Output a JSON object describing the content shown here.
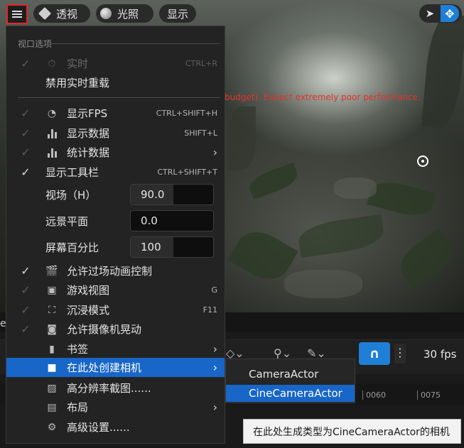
{
  "toolbar": {
    "perspective_label": "透视",
    "lighting_label": "光照",
    "show_label": "显示"
  },
  "viewport": {
    "warning_text": "budget). Expect extremely poor performance."
  },
  "menu": {
    "section_title": "视口选项",
    "realtime": {
      "label": "实时",
      "shortcut": "CTRL+R"
    },
    "disable_realtime_override": {
      "label": "禁用实时重载"
    },
    "show_fps": {
      "label": "显示FPS",
      "shortcut": "CTRL+SHIFT+H"
    },
    "show_stats": {
      "label": "显示数据",
      "shortcut": "SHIFT+L"
    },
    "stat_data": {
      "label": "统计数据"
    },
    "show_toolbar": {
      "label": "显示工具栏",
      "shortcut": "CTRL+SHIFT+T"
    },
    "fov": {
      "label": "视场（H）",
      "value": "90.0"
    },
    "far_plane": {
      "label": "远景平面",
      "value": "0.0"
    },
    "screen_percentage": {
      "label": "屏幕百分比",
      "value": "100"
    },
    "cinematic_control": {
      "label": "允许过场动画控制"
    },
    "game_view": {
      "label": "游戏视图",
      "shortcut": "G"
    },
    "immersive_mode": {
      "label": "沉浸模式",
      "shortcut": "F11"
    },
    "camera_shake": {
      "label": "允许摄像机晃动"
    },
    "bookmarks": {
      "label": "书签"
    },
    "create_camera_here": {
      "label": "在此处创建相机"
    },
    "high_res_screenshot": {
      "label": "高分辨率截图......"
    },
    "layouts": {
      "label": "布局"
    },
    "advanced_settings": {
      "label": "高级设置......"
    }
  },
  "submenu": {
    "camera_actor": "CameraActor",
    "cine_camera_actor": "CineCameraActor"
  },
  "tooltip": {
    "text": "在此处生成类型为CineCameraActor的相机"
  },
  "lower_panel": {
    "fps_label": "30 fps",
    "snap_label": "∩",
    "ticks": [
      "0060",
      "0075"
    ],
    "left_fragment": "er"
  },
  "colors": {
    "accent_blue": "#1766c8",
    "highlight_border": "#e2272c",
    "warning_red": "#e0352b"
  }
}
